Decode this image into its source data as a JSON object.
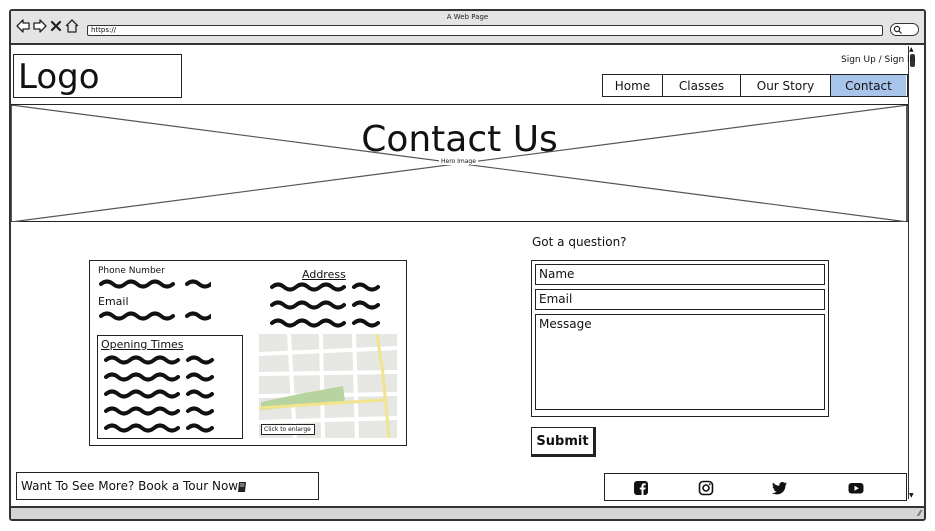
{
  "window": {
    "title": "A Web Page"
  },
  "address_bar": {
    "url": "https://"
  },
  "header": {
    "logo": "Logo",
    "auth_link": "Sign Up / Sign In",
    "nav": [
      {
        "label": "Home",
        "active": false
      },
      {
        "label": "Classes",
        "active": false
      },
      {
        "label": "Our Story",
        "active": false
      },
      {
        "label": "Contact",
        "active": true
      }
    ],
    "active_color": "#a9c4eb"
  },
  "hero": {
    "title": "Contact Us",
    "placeholder_label": "Hero Image"
  },
  "contact_card": {
    "phone_label": "Phone Number",
    "email_label": "Email",
    "address_label": "Address",
    "opening_times_label": "Opening Times",
    "map_button": "Click to enlarge"
  },
  "form": {
    "heading": "Got a question?",
    "name_placeholder": "Name",
    "email_placeholder": "Email",
    "message_placeholder": "Message",
    "submit_label": "Submit"
  },
  "footer": {
    "tour_text": "Want To See More? Book a Tour Now",
    "tour_icon": "book-icon",
    "social_icons": [
      "facebook-icon",
      "instagram-icon",
      "twitter-icon",
      "youtube-icon"
    ]
  }
}
